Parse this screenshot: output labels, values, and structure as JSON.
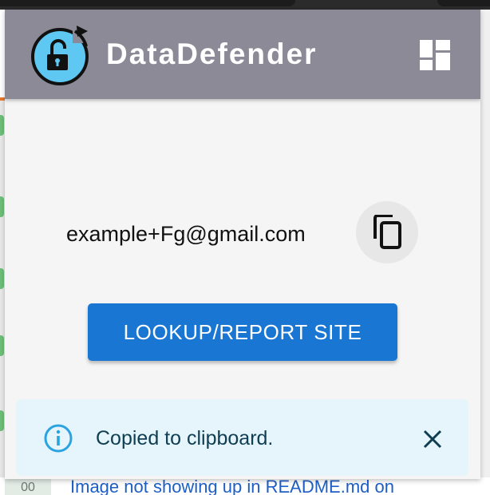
{
  "app": {
    "title": "DataDefender"
  },
  "email": {
    "address": "example+Fg@gmail.com"
  },
  "actions": {
    "lookup_label": "LOOKUP/REPORT SITE"
  },
  "alert": {
    "message": "Copied to clipboard."
  },
  "background_page": {
    "badge_text": "00",
    "link_text": "Image not showing up in README.md on"
  },
  "icons": {
    "logo": "unlocked-padlock-refresh-icon",
    "dashboard": "dashboard-icon",
    "copy": "copy-icon",
    "info": "info-icon",
    "close": "close-icon"
  },
  "colors": {
    "header": "#8c8a96",
    "accent": "#1976d2",
    "logo_circle": "#5ec8f3",
    "alert_bg": "#e5f5fb",
    "alert_icon": "#2aa3e0"
  }
}
